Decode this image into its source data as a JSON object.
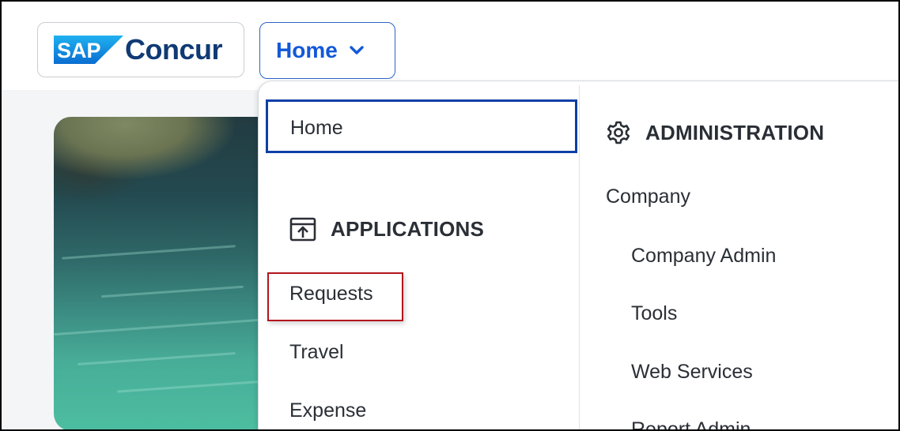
{
  "header": {
    "logo": {
      "sap_mark": "SAP",
      "product_name": "Concur"
    },
    "home_button_label": "Home",
    "home_button_icon": "chevron-down-icon"
  },
  "menu": {
    "home_item_label": "Home",
    "applications": {
      "header": "APPLICATIONS",
      "icon": "app-launch-icon",
      "items": [
        {
          "label": "Requests"
        },
        {
          "label": "Travel"
        },
        {
          "label": "Expense"
        }
      ]
    },
    "administration": {
      "header": "ADMINISTRATION",
      "icon": "gear-icon",
      "group_label": "Company",
      "items": [
        {
          "label": "Company Admin"
        },
        {
          "label": "Tools"
        },
        {
          "label": "Web Services"
        },
        {
          "label": "Report Admin"
        }
      ]
    }
  },
  "colors": {
    "brand_blue": "#103a74",
    "accent_blue": "#1358d8",
    "focus_border": "#0d3fa6",
    "annotation_red": "#b4161b"
  }
}
